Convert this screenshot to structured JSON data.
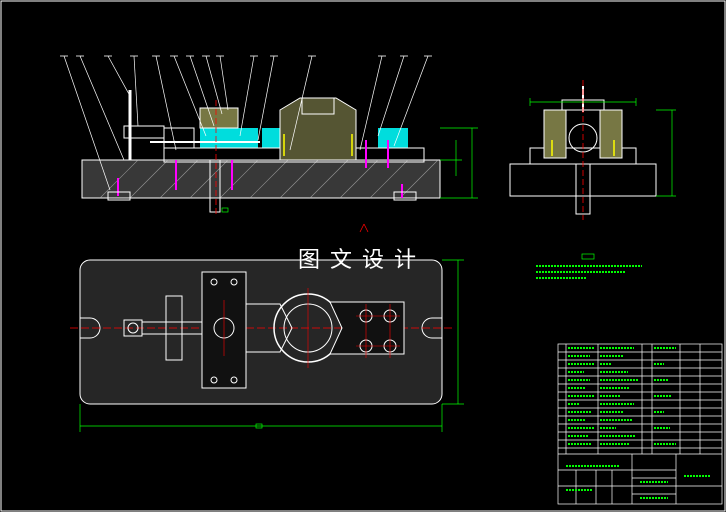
{
  "watermark": {
    "text": "图文设计"
  },
  "colors": {
    "background": "#000000",
    "outline": "#ffffff",
    "dimension": "#00ff00",
    "section_hatch": "#00ffff",
    "leader": "#ffffff",
    "centerline": "#ff0000",
    "threads": "#ff00ff",
    "highlight": "#ffff00",
    "title_block": "#ffffff"
  },
  "views": [
    "front-section-view",
    "side-section-view",
    "plan-view"
  ],
  "notes_block_lines": 3,
  "parts_list_rows": 14
}
